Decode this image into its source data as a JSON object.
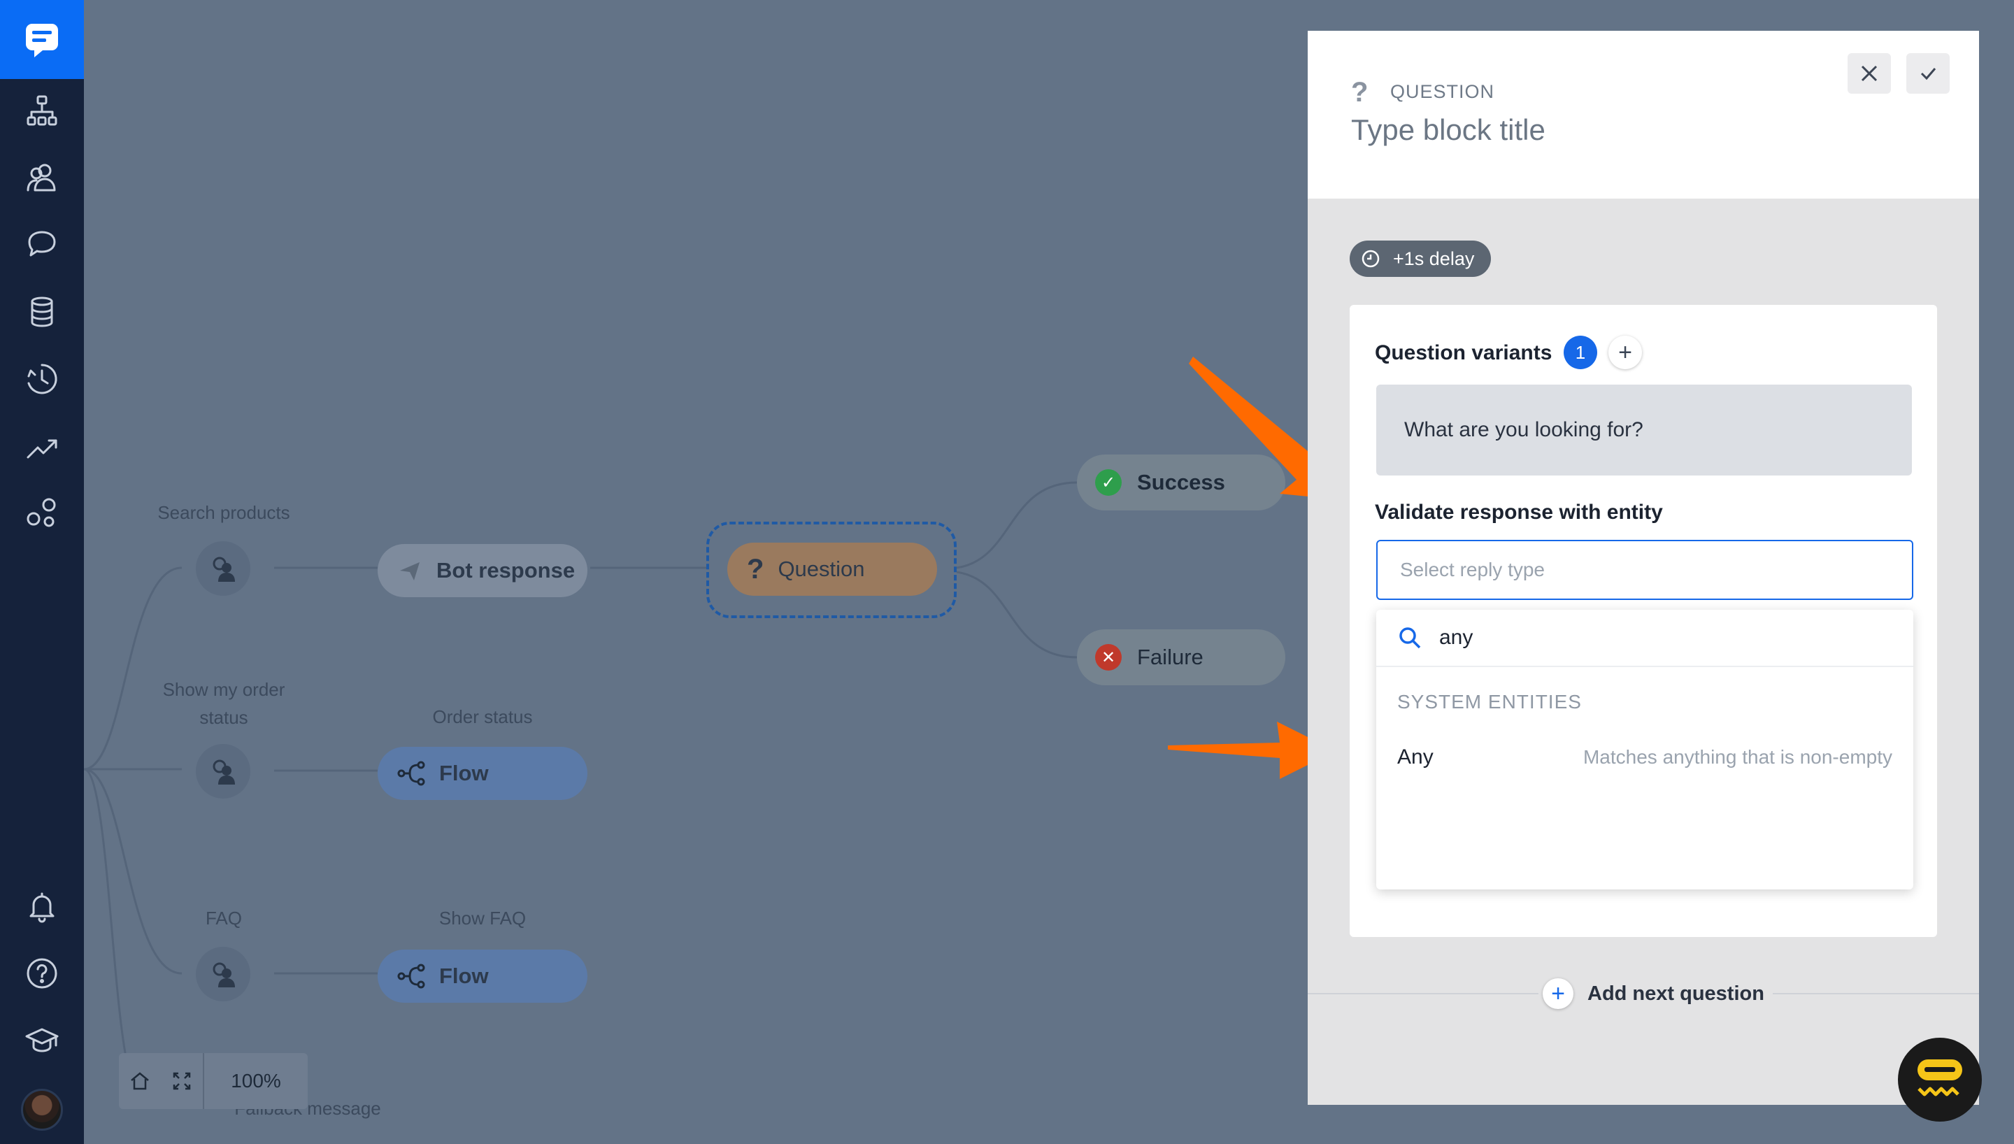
{
  "canvas": {
    "nodes": {
      "search_products": "Search products",
      "show_order_status": "Show my order status",
      "order_status": "Order status",
      "faq": "FAQ",
      "show_faq": "Show FAQ",
      "fallback_message": "Fallback message",
      "bot_response": "Bot response",
      "question": "Question",
      "flow_1": "Flow",
      "flow_2": "Flow",
      "success": "Success",
      "failure": "Failure"
    },
    "zoom": "100%"
  },
  "panel": {
    "block_kind": "QUESTION",
    "title_placeholder": "Type block title",
    "delay": "+1s delay",
    "question_variants_label": "Question variants",
    "variants_count": "1",
    "variant_text": "What are you looking for?",
    "validate_label": "Validate response with entity",
    "select_placeholder": "Select reply type",
    "search_query": "any",
    "group_label": "SYSTEM ENTITIES",
    "option_name": "Any",
    "option_desc": "Matches anything that is non-empty",
    "add_next_question": "Add next question"
  },
  "colors": {
    "sidebar": "#15223b",
    "brand": "#0a6cf5",
    "canvas_bg": "#637387",
    "arrow": "#ff6a00"
  },
  "icons": [
    "chat-logo-icon",
    "flows-icon",
    "users-icon",
    "conversations-icon",
    "database-icon",
    "history-icon",
    "analytics-icon",
    "integrations-icon",
    "bell-icon",
    "help-icon",
    "academy-icon"
  ]
}
